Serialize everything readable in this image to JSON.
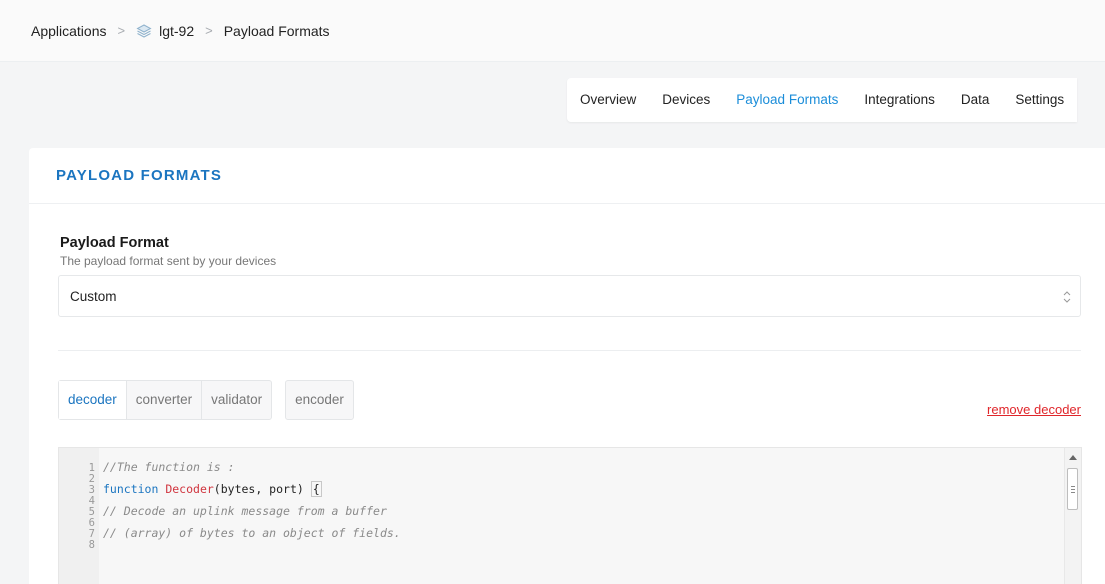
{
  "breadcrumb": {
    "items": [
      "Applications",
      "lgt-92",
      "Payload Formats"
    ],
    "separator": ">"
  },
  "tabs": [
    {
      "label": "Overview"
    },
    {
      "label": "Devices"
    },
    {
      "label": "Payload Formats",
      "active": true
    },
    {
      "label": "Integrations"
    },
    {
      "label": "Data"
    },
    {
      "label": "Settings"
    }
  ],
  "card": {
    "title": "PAYLOAD FORMATS",
    "field_label": "Payload Format",
    "field_desc": "The payload format sent by your devices",
    "select_value": "Custom"
  },
  "subtabs": {
    "group1": [
      "decoder",
      "converter",
      "validator"
    ],
    "group2": [
      "encoder"
    ],
    "active": "decoder"
  },
  "remove_label": "remove decoder",
  "editor": {
    "lines": [
      {
        "n": "1",
        "text": "//The function is :"
      },
      {
        "n": "2",
        "text": ""
      },
      {
        "n": "3",
        "text": "function Decoder(bytes, port) {"
      },
      {
        "n": "4",
        "text": ""
      },
      {
        "n": "5",
        "text": "// Decode an uplink message from a buffer"
      },
      {
        "n": "6",
        "text": ""
      },
      {
        "n": "7",
        "text": "// (array) of bytes to an object of fields."
      },
      {
        "n": "8",
        "text": ""
      }
    ]
  },
  "colors": {
    "accent": "#1b8dd9",
    "title": "#1b75c0",
    "danger": "#e0262b"
  }
}
